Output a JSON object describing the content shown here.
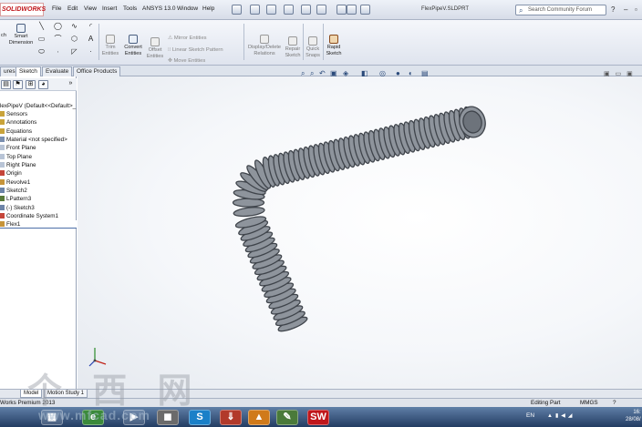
{
  "app": {
    "logo": "SOLIDWORKS",
    "document_title": "FlexPipeV.SLDPRT",
    "search_placeholder": "Search Community Forum"
  },
  "menu": [
    "File",
    "Edit",
    "View",
    "Insert",
    "Tools",
    "ANSYS 13.0",
    "Window",
    "Help"
  ],
  "command_manager": {
    "smart_dimension": "Smart\nDimension",
    "trim": "Trim\nEntities",
    "convert": "Convert\nEntities",
    "offset": "Offset\nEntities",
    "mirror": "Mirror Entities",
    "linear_pattern": "Linear Sketch Pattern",
    "move": "Move Entities",
    "display_delete": "Display/Delete\nRelations",
    "repair": "Repair\nSketch",
    "quick_snaps": "Quick\nSnaps",
    "rapid_sketch": "Rapid\nSketch",
    "left_cut": "ch"
  },
  "tabs": [
    "ures",
    "Sketch",
    "Evaluate",
    "Office Products"
  ],
  "active_tab": "Sketch",
  "feature_tree": {
    "root": "lexPipeV  (Default<<Default>_",
    "items": [
      "Sensors",
      "Annotations",
      "Equations",
      "Material <not specified>",
      "Front Plane",
      "Top Plane",
      "Right Plane",
      "Origin",
      "Revolve1",
      "Sketch2",
      "LPattern3",
      "(-) Sketch3",
      "Coordinate System1",
      "Flex1"
    ]
  },
  "bottom_tabs": [
    "Model",
    "Motion Study 1"
  ],
  "status": {
    "left": "Works Premium 2013",
    "mode": "Editing Part",
    "units": "MMGS"
  },
  "taskbar": {
    "lang": "EN",
    "time": "16:",
    "date": "28/08/"
  },
  "watermark": {
    "chinese": "个 西 网",
    "url": "www.mfcad.com"
  },
  "colors": {
    "part": "#8e949c",
    "part_dark": "#3f444b",
    "taskbar": "#2f4c78",
    "logo_red": "#c0161b"
  }
}
